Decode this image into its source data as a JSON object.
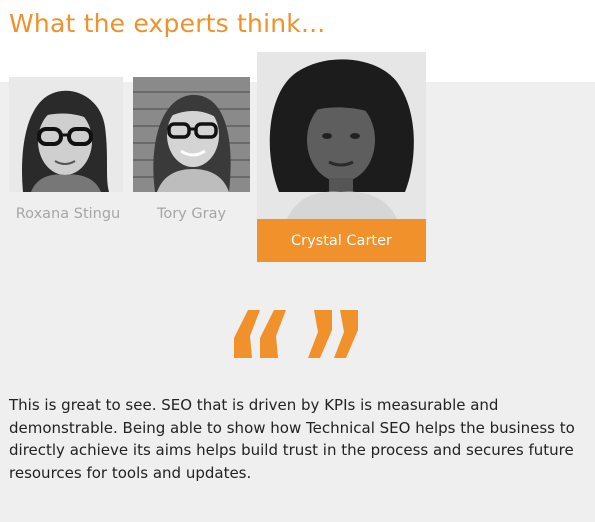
{
  "section": {
    "title": "What the experts think..."
  },
  "experts": [
    {
      "name": "Roxana Stingu",
      "active": false
    },
    {
      "name": "Tory Gray",
      "active": false
    },
    {
      "name": "Crystal Carter",
      "active": true
    }
  ],
  "quote": {
    "icon": "quote-marks-icon",
    "text": "This is great to see. SEO that is driven by KPIs is measurable and demonstrable. Being able to show how Technical SEO helps the business to directly achieve its aims helps build trust in the process and secures future resources for tools and updates."
  },
  "colors": {
    "accent": "#f0912b",
    "background": "#efefef",
    "inactive_name": "#a6a6a6"
  }
}
